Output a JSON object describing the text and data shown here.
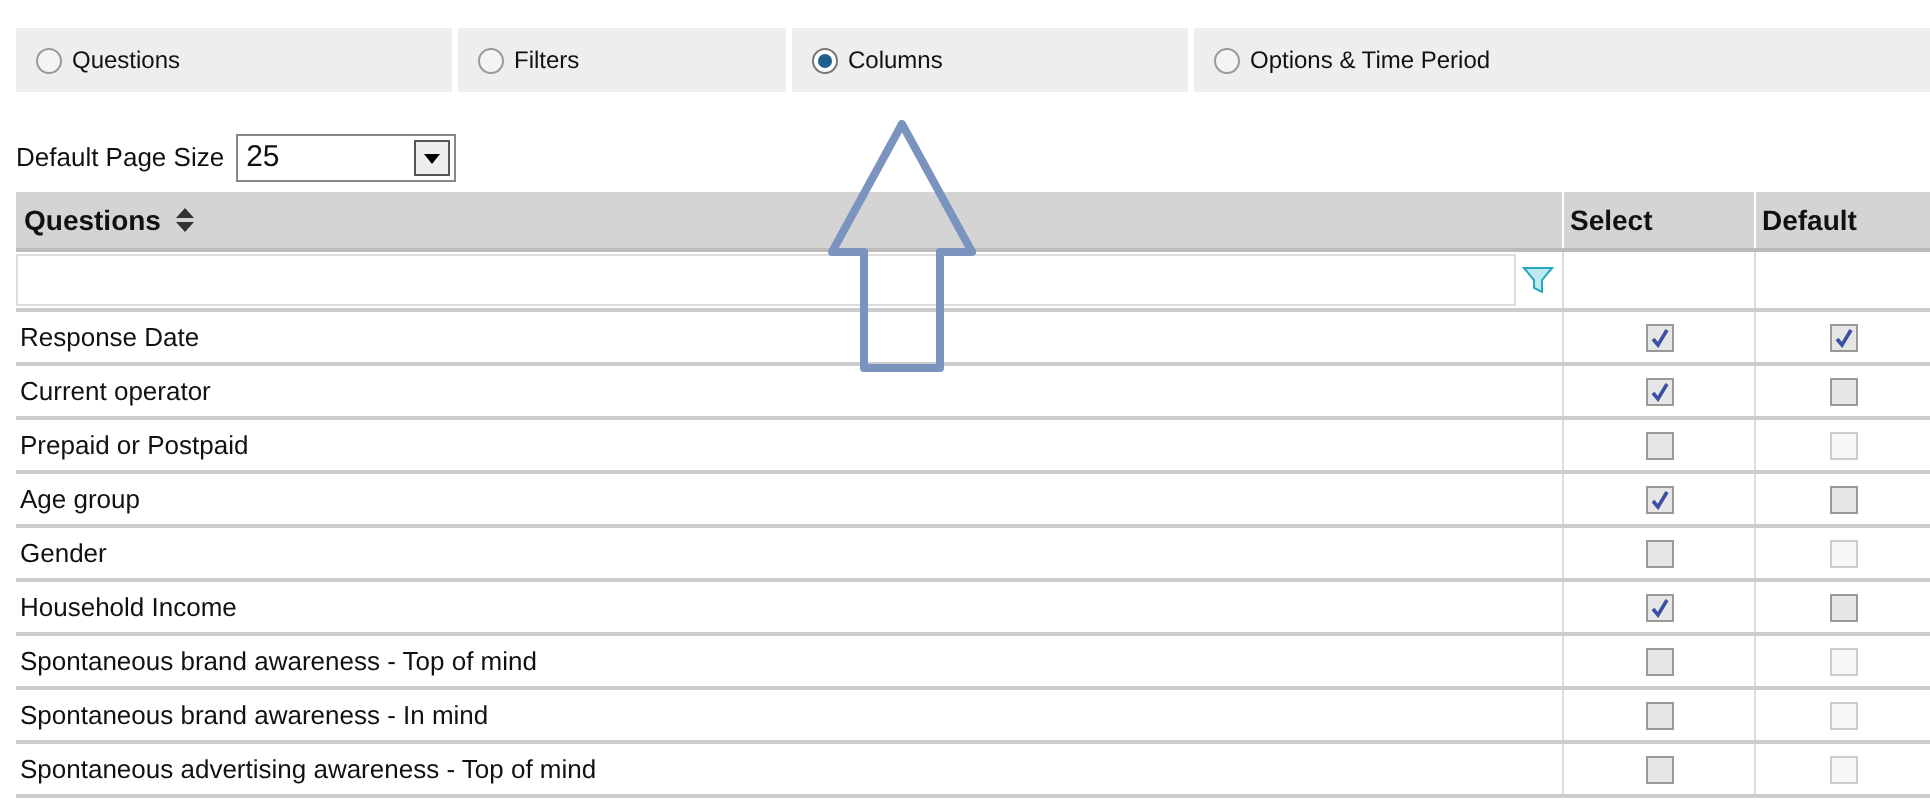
{
  "tabs": [
    {
      "label": "Questions",
      "selected": false
    },
    {
      "label": "Filters",
      "selected": false
    },
    {
      "label": "Columns",
      "selected": true
    },
    {
      "label": "Options & Time Period",
      "selected": false
    }
  ],
  "page_size": {
    "label": "Default Page Size",
    "value": "25"
  },
  "table": {
    "columns": [
      "Questions",
      "Select",
      "Default"
    ],
    "rows": [
      {
        "question": "Response Date",
        "select": {
          "checked": true
        },
        "default": {
          "checked": true,
          "disabled": false
        }
      },
      {
        "question": "Current operator",
        "select": {
          "checked": true
        },
        "default": {
          "checked": false,
          "disabled": false
        }
      },
      {
        "question": "Prepaid or Postpaid",
        "select": {
          "checked": false
        },
        "default": {
          "checked": false,
          "disabled": true
        }
      },
      {
        "question": "Age group",
        "select": {
          "checked": true
        },
        "default": {
          "checked": false,
          "disabled": false
        }
      },
      {
        "question": "Gender",
        "select": {
          "checked": false
        },
        "default": {
          "checked": false,
          "disabled": true
        }
      },
      {
        "question": "Household Income",
        "select": {
          "checked": true
        },
        "default": {
          "checked": false,
          "disabled": false
        }
      },
      {
        "question": "Spontaneous brand awareness - Top of mind",
        "select": {
          "checked": false
        },
        "default": {
          "checked": false,
          "disabled": true
        }
      },
      {
        "question": "Spontaneous brand awareness - In mind",
        "select": {
          "checked": false
        },
        "default": {
          "checked": false,
          "disabled": true
        }
      },
      {
        "question": "Spontaneous advertising awareness - Top of mind",
        "select": {
          "checked": false
        },
        "default": {
          "checked": false,
          "disabled": true
        }
      }
    ]
  }
}
